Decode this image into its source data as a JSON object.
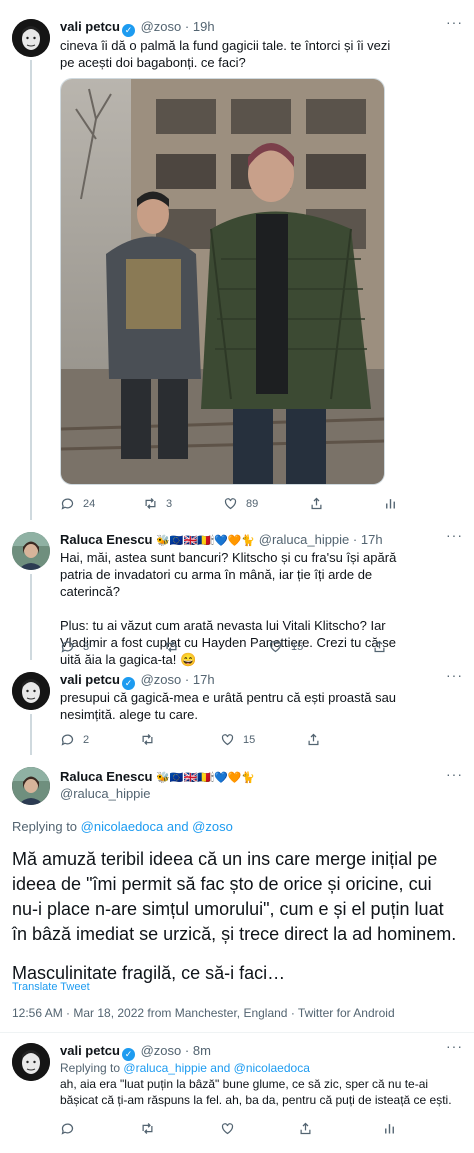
{
  "tweets": [
    {
      "name": "vali petcu",
      "handle": "@zoso",
      "time": "19h",
      "text": "cineva îi dă o palmă la fund gagicii tale. te întorci și îi vezi pe acești doi bagabonți. ce faci?",
      "replies": "24",
      "retweets": "3",
      "likes": "89"
    },
    {
      "name": "Raluca Enescu",
      "emojis": "🐝🇪🇺🇬🇧🇷🇴🕯💙🧡🐈",
      "handle": "@raluca_hippie",
      "time": "17h",
      "text_p1": "Hai, măi, astea sunt bancuri? Klitscho și cu fra'su își apără patria de invadatori cu arma în mână, iar ție îți arde de caterincă?",
      "text_p2": "Plus: tu ai văzut cum arată nevasta lui Vitali Klitscho? Iar Vladimir a fost cuplat cu Hayden Panettiere. Crezi tu că se uită ăia la gagica-ta! 😄",
      "replies": "3",
      "retweets": "",
      "likes": "15"
    },
    {
      "name": "vali petcu",
      "handle": "@zoso",
      "time": "17h",
      "text": "presupui că gagică-mea e urâtă pentru că ești proastă sau nesimțită. alege tu care.",
      "replies": "2",
      "retweets": "",
      "likes": "15"
    }
  ],
  "focused": {
    "name": "Raluca Enescu",
    "emojis": "🐝🇪🇺🇬🇧🇷🇴🕯💙🧡🐈",
    "handle": "@raluca_hippie",
    "replying_prefix": "Replying to",
    "replying_users": "@nicolaedoca and @zoso",
    "p1": "Mă amuză teribil ideea că un ins care merge inițial pe ideea de \"îmi permit să fac șto de orice și oricine, cui nu-i place n-are simțul umorului\", cum e și el puțin luat în bâză imediat se urzică, și trece direct la ad hominem.",
    "p2": "Masculinitate fragilă, ce să-i faci…",
    "translate": "Translate Tweet",
    "meta": "12:56 AM · Mar 18, 2022 from Manchester, England · Twitter for Android"
  },
  "last_reply": {
    "name": "vali petcu",
    "handle": "@zoso",
    "time": "8m",
    "replying_prefix": "Replying to",
    "replying_users": "@raluca_hippie and @nicolaedoca",
    "text": "ah, aia era \"luat puțin la bâză\" bune glume, ce să zic, sper că nu te-ai bășicat că ți-am răspuns la fel.  ah, ba da, pentru că puți de isteață ce ești."
  },
  "colors": {
    "accent": "#1d9bf0",
    "muted": "#536471",
    "divider": "#eff3f4"
  }
}
